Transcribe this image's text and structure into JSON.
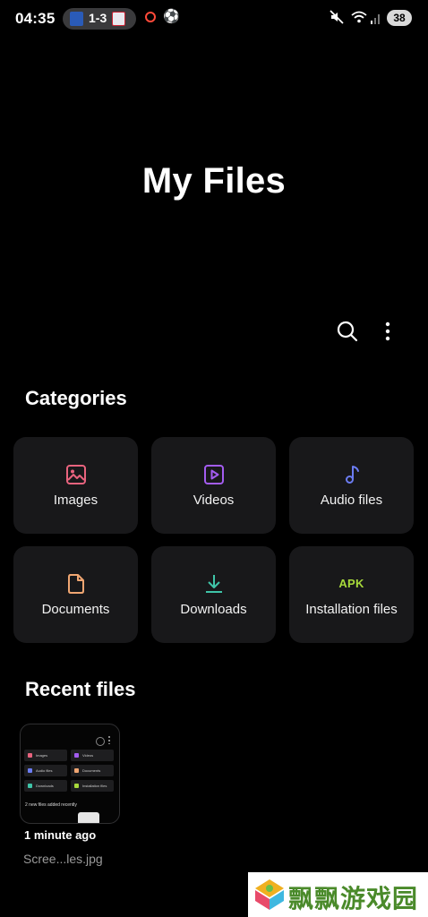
{
  "status_bar": {
    "time": "04:35",
    "score": "1-3",
    "battery": "38",
    "icons": [
      "team-badge-home",
      "team-badge-away",
      "notification-ring",
      "football",
      "mute",
      "wifi",
      "signal"
    ]
  },
  "header": {
    "title": "My Files",
    "actions": [
      "search-icon",
      "more-options-icon"
    ]
  },
  "categories": {
    "title": "Categories",
    "items": [
      {
        "label": "Images",
        "icon": "image-icon",
        "color": "#e8637e"
      },
      {
        "label": "Videos",
        "icon": "video-icon",
        "color": "#a35cf0"
      },
      {
        "label": "Audio files",
        "icon": "music-note-icon",
        "color": "#6b7cf2"
      },
      {
        "label": "Documents",
        "icon": "document-icon",
        "color": "#f0a672"
      },
      {
        "label": "Downloads",
        "icon": "download-icon",
        "color": "#3fc4a8"
      },
      {
        "label": "Installation files",
        "icon": "apk-icon",
        "badge": "APK",
        "color": "#a7d93b"
      }
    ]
  },
  "recent": {
    "title": "Recent files",
    "files": [
      {
        "time": "1 minute ago",
        "name": "Scree...les.jpg",
        "thumbnail_banner": "2 new files added recently"
      }
    ]
  },
  "watermark": {
    "text": "飘飘游戏园"
  }
}
